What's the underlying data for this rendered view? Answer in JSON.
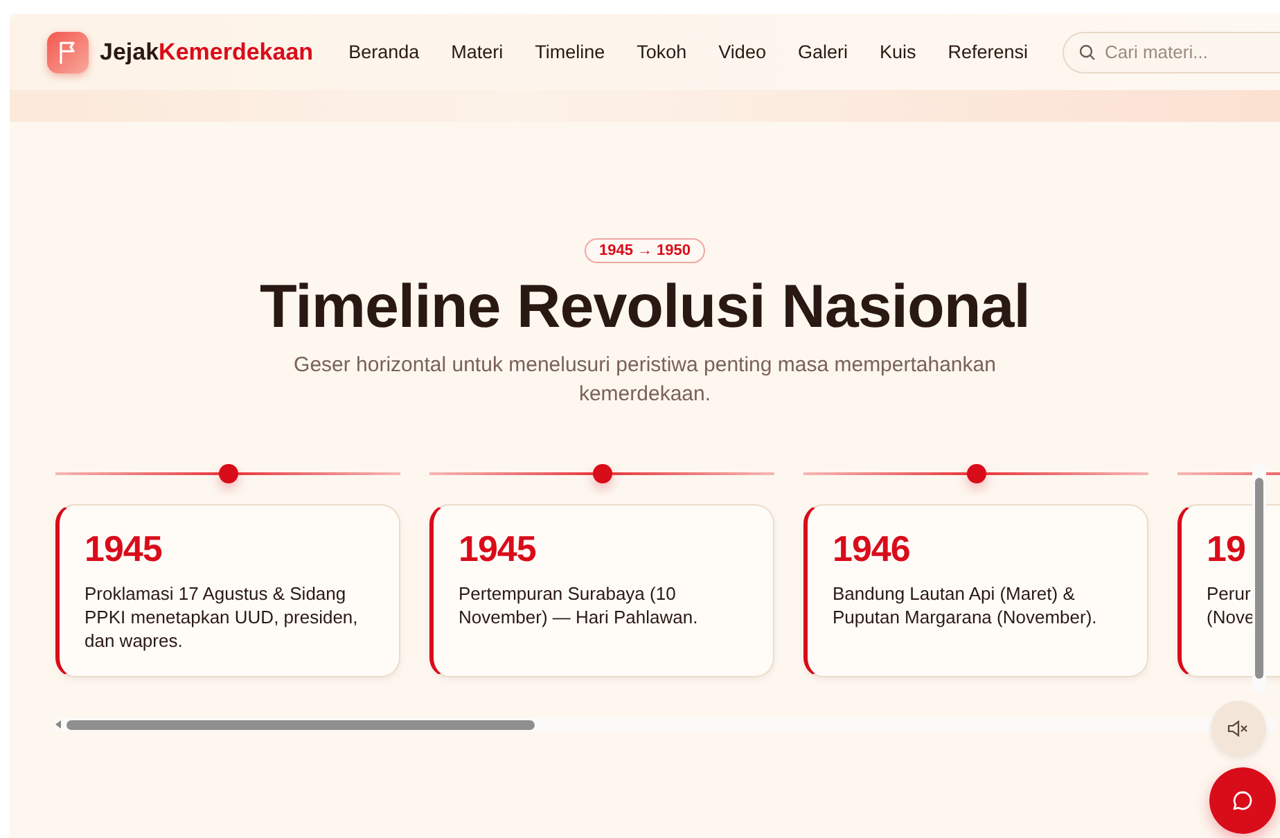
{
  "brand": {
    "first": "Jejak",
    "second": "Kemerdekaan"
  },
  "nav": [
    {
      "label": "Beranda"
    },
    {
      "label": "Materi"
    },
    {
      "label": "Timeline"
    },
    {
      "label": "Tokoh"
    },
    {
      "label": "Video"
    },
    {
      "label": "Galeri"
    },
    {
      "label": "Kuis"
    },
    {
      "label": "Referensi"
    }
  ],
  "search": {
    "placeholder": "Cari materi..."
  },
  "section": {
    "badge": "1945 → 1950",
    "title": "Timeline Revolusi Nasional",
    "subtitle": "Geser horizontal untuk menelusuri peristiwa penting masa mempertahankan kemerdekaan."
  },
  "events": [
    {
      "year": "1945",
      "lines": [
        "Proklamasi 17 Agustus & Sidang",
        "PPKI menetapkan UUD, presiden,",
        "dan wapres."
      ]
    },
    {
      "year": "1945",
      "lines": [
        "Pertempuran Surabaya (10",
        "November) — Hari Pahlawan."
      ]
    },
    {
      "year": "1946",
      "lines": [
        "Bandung Lautan Api (Maret) &",
        "Puputan Margarana (November)."
      ]
    },
    {
      "year": "19",
      "lines": [
        "Perur",
        "(Nove"
      ]
    }
  ]
}
